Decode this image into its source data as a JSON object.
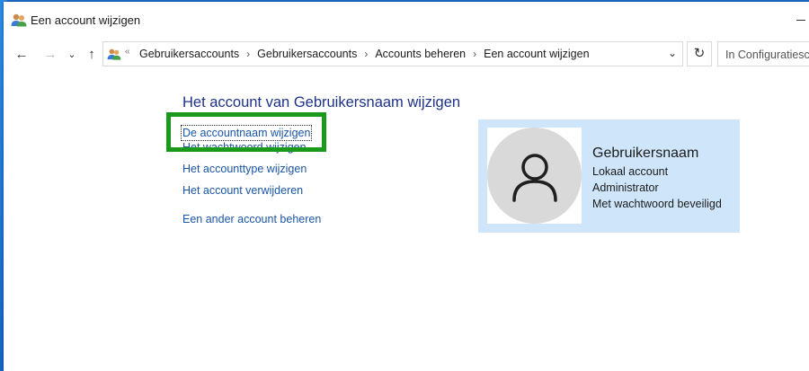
{
  "window": {
    "title": "Een account wijzigen"
  },
  "address_bar": {
    "breadcrumbs": [
      "Gebruikersaccounts",
      "Gebruikersaccounts",
      "Accounts beheren",
      "Een account wijzigen"
    ],
    "search_placeholder": "In Configuratiescherm zoeken"
  },
  "main": {
    "title": "Het account van Gebruikersnaam wijzigen",
    "links": {
      "rename": "De accountnaam wijzigen",
      "password": "Het wachtwoord wijzigen",
      "account_type": "Het accounttype wijzigen",
      "delete": "Het account verwijderen",
      "manage_other": "Een ander account beheren"
    }
  },
  "account_card": {
    "name": "Gebruikersnaam",
    "type": "Lokaal account",
    "role": "Administrator",
    "protection": "Met wachtwoord beveiligd"
  },
  "colors": {
    "highlight": "#1a9a1a",
    "link": "#1a56a8",
    "title": "#1e3287",
    "card": "#cfe6fa"
  }
}
